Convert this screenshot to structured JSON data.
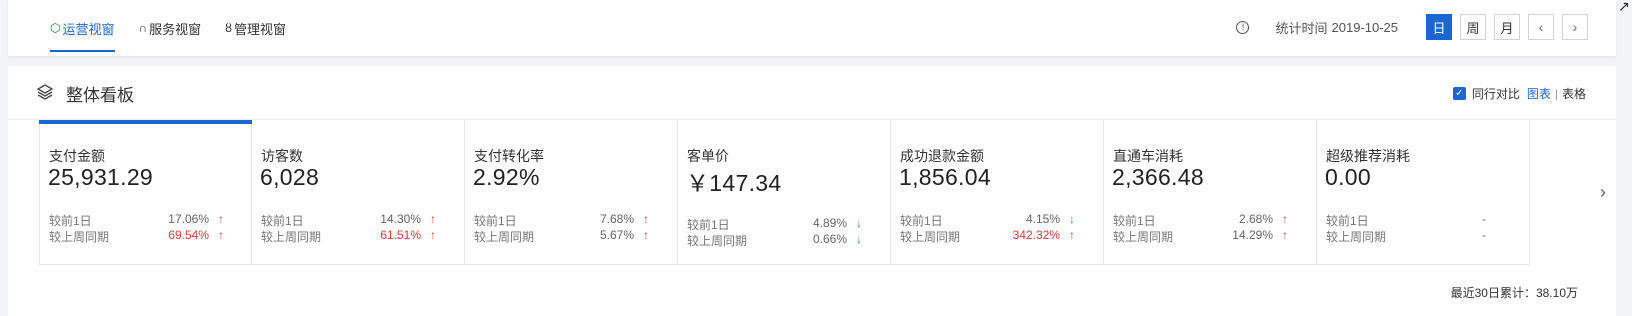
{
  "tabs": [
    {
      "label": "运营视窗",
      "icon": "hexagon-icon",
      "active": true
    },
    {
      "label": "服务视窗",
      "icon": "headset-icon",
      "active": false
    },
    {
      "label": "管理视窗",
      "icon": "user-icon",
      "active": false
    }
  ],
  "header": {
    "stat_label": "统计时间",
    "stat_date": "2019-10-25",
    "periods": [
      "日",
      "周",
      "月"
    ],
    "active_period": "日"
  },
  "panel": {
    "title": "整体看板",
    "compare_label": "同行对比",
    "view_chart": "图表",
    "view_sep": "|",
    "view_table": "表格"
  },
  "cards": [
    {
      "label": "支付金额",
      "value": "25,931.29",
      "prev_day_label": "较前1日",
      "prev_day_pct": "17.06%",
      "prev_day_dir": "up",
      "prev_day_red": false,
      "prev_week_label": "较上周同期",
      "prev_week_pct": "69.54%",
      "prev_week_dir": "up",
      "prev_week_red": true
    },
    {
      "label": "访客数",
      "value": "6,028",
      "prev_day_label": "较前1日",
      "prev_day_pct": "14.30%",
      "prev_day_dir": "up",
      "prev_day_red": false,
      "prev_week_label": "较上周同期",
      "prev_week_pct": "61.51%",
      "prev_week_dir": "up",
      "prev_week_red": true
    },
    {
      "label": "支付转化率",
      "value": "2.92%",
      "prev_day_label": "较前1日",
      "prev_day_pct": "7.68%",
      "prev_day_dir": "up",
      "prev_day_red": false,
      "prev_week_label": "较上周同期",
      "prev_week_pct": "5.67%",
      "prev_week_dir": "up",
      "prev_week_red": false
    },
    {
      "label": "客单价",
      "value": "￥147.34",
      "prev_day_label": "较前1日",
      "prev_day_pct": "4.89%",
      "prev_day_dir": "down",
      "prev_day_red": false,
      "prev_week_label": "较上周同期",
      "prev_week_pct": "0.66%",
      "prev_week_dir": "down",
      "prev_week_red": false
    },
    {
      "label": "成功退款金额",
      "value": "1,856.04",
      "prev_day_label": "较前1日",
      "prev_day_pct": "4.15%",
      "prev_day_dir": "down",
      "prev_day_red": false,
      "prev_week_label": "较上周同期",
      "prev_week_pct": "342.32%",
      "prev_week_dir": "up",
      "prev_week_red": true
    },
    {
      "label": "直通车消耗",
      "value": "2,366.48",
      "prev_day_label": "较前1日",
      "prev_day_pct": "2.68%",
      "prev_day_dir": "up",
      "prev_day_red": false,
      "prev_week_label": "较上周同期",
      "prev_week_pct": "14.29%",
      "prev_week_dir": "up",
      "prev_week_red": false
    },
    {
      "label": "超级推荐消耗",
      "value": "0.00",
      "prev_day_label": "较前1日",
      "prev_day_pct": "-",
      "prev_day_dir": "none",
      "prev_day_red": false,
      "prev_week_label": "较上周同期",
      "prev_week_pct": "-",
      "prev_week_dir": "none",
      "prev_week_red": false
    }
  ],
  "footer": {
    "total_text": "最近30日累计：38.10万"
  },
  "colors": {
    "accent": "#1a66d2",
    "up": "#e0403a",
    "down": "#27a34a"
  }
}
